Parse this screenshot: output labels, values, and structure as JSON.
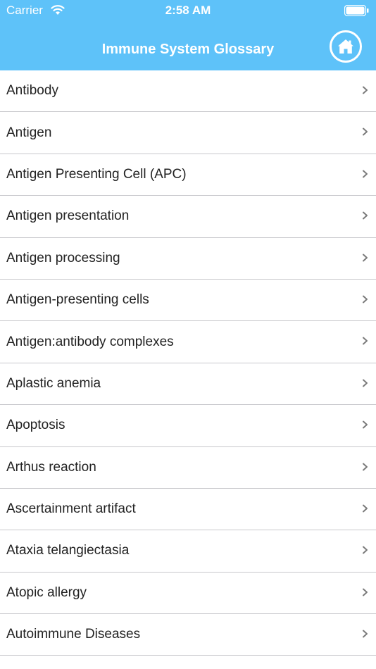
{
  "status_bar": {
    "carrier": "Carrier",
    "time": "2:58 AM",
    "wifi_icon": "wifi-icon",
    "battery_icon": "battery-icon"
  },
  "nav": {
    "title": "Immune System Glossary",
    "home_icon": "home-icon"
  },
  "colors": {
    "header_background": "#5ec2f9",
    "header_text": "#ffffff",
    "row_text": "#222222",
    "separator": "#c8c8cc",
    "chevron": "#7a7a7a"
  },
  "list": {
    "items": [
      {
        "label": "Antibody"
      },
      {
        "label": "Antigen"
      },
      {
        "label": "Antigen Presenting Cell (APC)"
      },
      {
        "label": "Antigen presentation"
      },
      {
        "label": "Antigen processing"
      },
      {
        "label": "Antigen-presenting cells"
      },
      {
        "label": "Antigen:antibody complexes"
      },
      {
        "label": "Aplastic anemia"
      },
      {
        "label": "Apoptosis"
      },
      {
        "label": "Arthus reaction"
      },
      {
        "label": "Ascertainment artifact"
      },
      {
        "label": "Ataxia telangiectasia"
      },
      {
        "label": "Atopic allergy"
      },
      {
        "label": "Autoimmune Diseases"
      }
    ]
  }
}
